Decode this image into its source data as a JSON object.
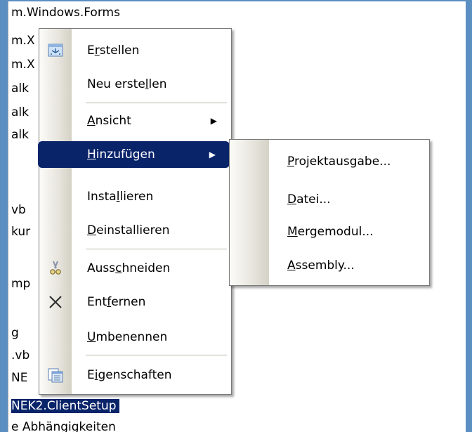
{
  "tree": {
    "lines": [
      "m.Windows.Forms",
      "m.X",
      "m.X",
      "alk",
      "alk",
      "alk",
      "vb",
      "kur",
      "mp",
      "g",
      ".vb",
      "NE",
      "NEK2.ClientSetup",
      "e Abhängigkeiten"
    ]
  },
  "context_menu": {
    "items": [
      {
        "label_pre": "E",
        "label_ul": "r",
        "label_post": "stellen",
        "icon": "build-icon"
      },
      {
        "label_pre": "Neu erste",
        "label_ul": "l",
        "label_post": "len"
      },
      {
        "label_pre": "",
        "label_ul": "A",
        "label_post": "nsicht",
        "submenu": true
      },
      {
        "label_pre": "",
        "label_ul": "H",
        "label_post": "inzufügen",
        "submenu": true,
        "highlighted": true
      },
      {
        "label_pre": "Insta",
        "label_ul": "l",
        "label_post": "lieren"
      },
      {
        "label_pre": "",
        "label_ul": "D",
        "label_post": "einstallieren"
      },
      {
        "label_pre": "Auss",
        "label_ul": "c",
        "label_post": "hneiden",
        "icon": "cut-icon"
      },
      {
        "label_pre": "Ent",
        "label_ul": "f",
        "label_post": "ernen",
        "icon": "delete-icon"
      },
      {
        "label_pre": "",
        "label_ul": "U",
        "label_post": "mbenennen"
      },
      {
        "label_pre": "E",
        "label_ul": "i",
        "label_post": "genschaften",
        "icon": "properties-icon"
      }
    ]
  },
  "submenu": {
    "items": [
      {
        "label_pre": "",
        "label_ul": "P",
        "label_post": "rojektausgabe..."
      },
      {
        "label_pre": "",
        "label_ul": "D",
        "label_post": "atei..."
      },
      {
        "label_pre": "",
        "label_ul": "M",
        "label_post": "ergemodul..."
      },
      {
        "label_pre": "",
        "label_ul": "A",
        "label_post": "ssembly..."
      }
    ]
  },
  "colors": {
    "highlight": "#0a246a",
    "frame": "#5b8fc2"
  }
}
